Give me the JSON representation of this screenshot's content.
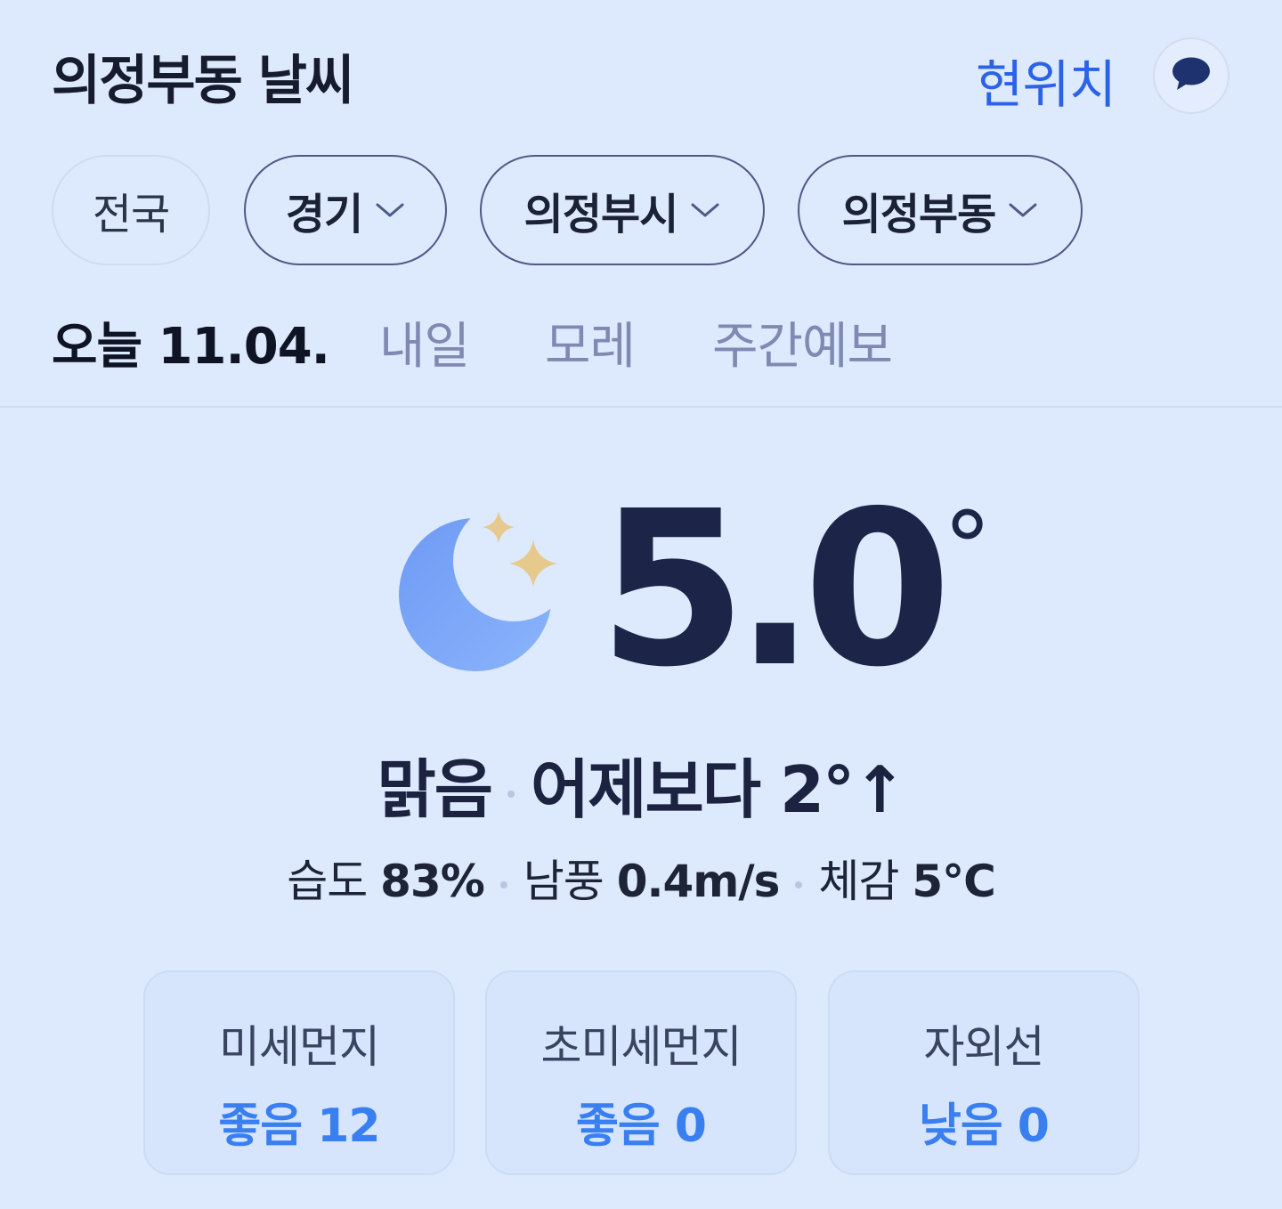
{
  "header": {
    "title": "의정부동 날씨",
    "location_button": "현위치",
    "chat_icon": "chat-bubble-icon"
  },
  "regions": {
    "items": [
      {
        "label": "전국",
        "has_dropdown": false
      },
      {
        "label": "경기",
        "has_dropdown": true
      },
      {
        "label": "의정부시",
        "has_dropdown": true
      },
      {
        "label": "의정부동",
        "has_dropdown": true
      }
    ]
  },
  "tabs": {
    "items": [
      {
        "label": "오늘 11.04.",
        "active": true
      },
      {
        "label": "내일",
        "active": false
      },
      {
        "label": "모레",
        "active": false
      },
      {
        "label": "주간예보",
        "active": false
      }
    ]
  },
  "current": {
    "icon": "moon-stars-icon",
    "temperature": "5.0",
    "degree_symbol": "°",
    "condition": "맑음",
    "comparison": "어제보다 2°↑",
    "humidity_label": "습도",
    "humidity_value": "83%",
    "wind_label": "남풍",
    "wind_value": "0.4m/s",
    "feels_label": "체감",
    "feels_value": "5°C"
  },
  "air_quality": [
    {
      "label": "미세먼지",
      "value": "좋음 12"
    },
    {
      "label": "초미세먼지",
      "value": "좋음 0"
    },
    {
      "label": "자외선",
      "value": "낮음 0"
    }
  ],
  "colors": {
    "background": "#dde9fc",
    "accent": "#2a63e6",
    "good_value": "#3a7ff0",
    "moon": "#7fa9f7",
    "star": "#e6c98d"
  }
}
